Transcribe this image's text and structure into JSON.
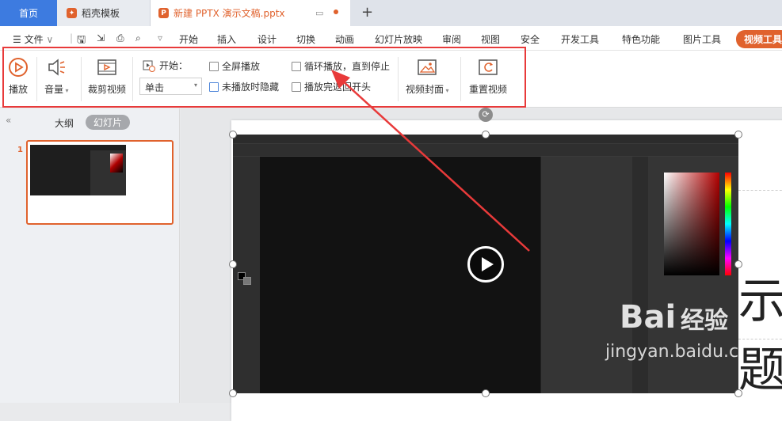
{
  "tabs": {
    "home": "首页",
    "templates": "稻壳模板",
    "doc": "新建 PPTX 演示文稿.pptx"
  },
  "menus": {
    "file": "文件",
    "items": [
      "开始",
      "插入",
      "设计",
      "切换",
      "动画",
      "幻灯片放映",
      "审阅",
      "视图",
      "安全",
      "开发工具",
      "特色功能",
      "图片工具"
    ],
    "video_tools": "视频工具"
  },
  "ribbon": {
    "play": "播放",
    "volume": "音量",
    "trim": "裁剪视频",
    "start_label": "开始：",
    "start_value": "单击",
    "fullscreen": "全屏播放",
    "hide": "未播放时隐藏",
    "loop": "循环播放，直到停止",
    "rewind": "播放完返回开头",
    "cover": "视频封面",
    "reset": "重置视频"
  },
  "panel": {
    "outline": "大纲",
    "slides": "幻灯片",
    "slide_number": "1"
  },
  "slide": {
    "title_partial": "示题"
  },
  "watermark": {
    "brand": "Bai",
    "brand2": "经验",
    "url": "jingyan.baidu.com"
  },
  "colors": {
    "accent": "#e0622d",
    "highlight": "#e83a3a",
    "home_tab": "#3d7be0"
  }
}
